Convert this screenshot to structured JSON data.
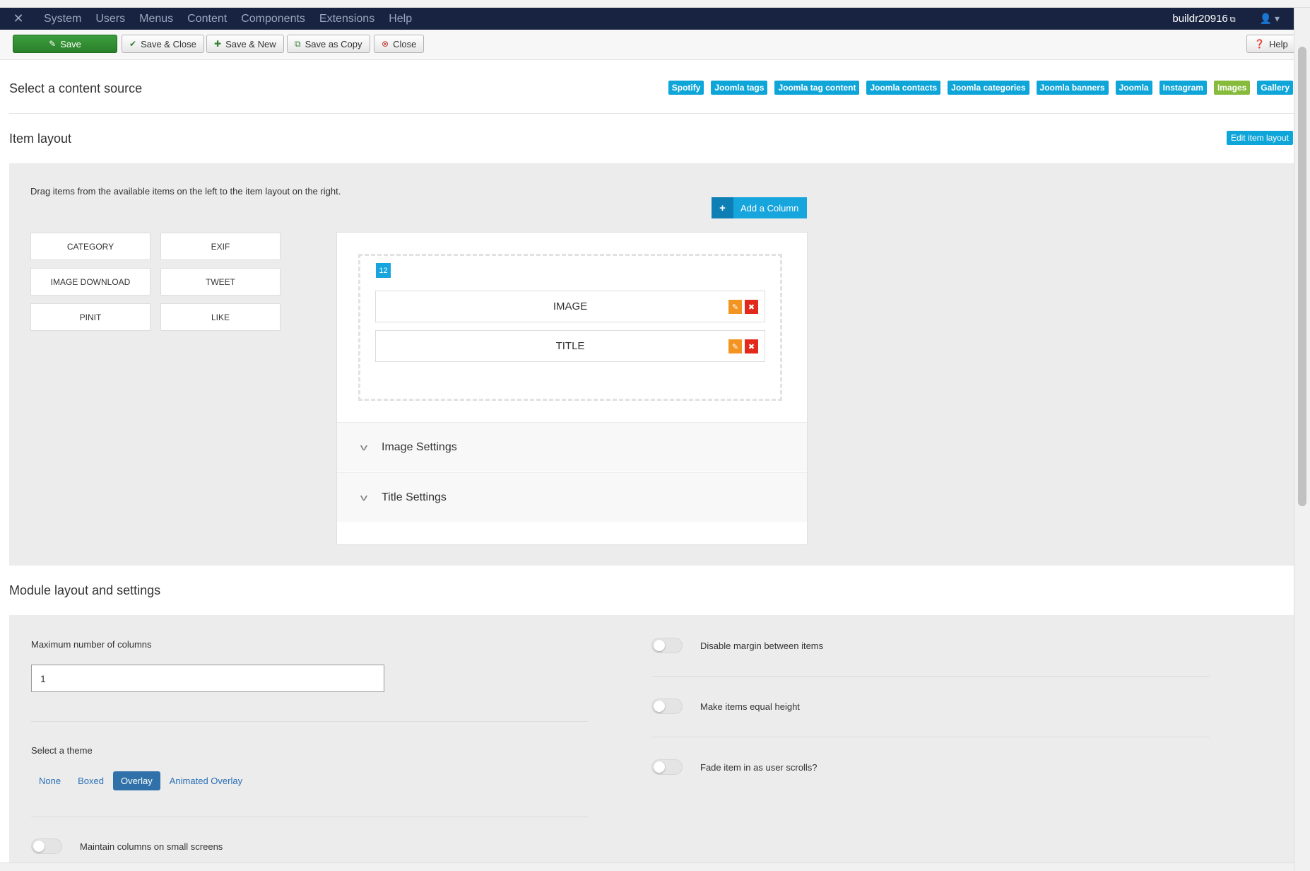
{
  "navbar": {
    "menu": [
      "System",
      "Users",
      "Menus",
      "Content",
      "Components",
      "Extensions",
      "Help"
    ],
    "user": "buildr20916"
  },
  "toolbar": {
    "save": "Save",
    "save_close": "Save & Close",
    "save_new": "Save & New",
    "save_copy": "Save as Copy",
    "close": "Close",
    "help": "Help"
  },
  "content_source": {
    "title": "Select a content source",
    "tags": [
      "Spotify",
      "Joomla tags",
      "Joomla tag content",
      "Joomla contacts",
      "Joomla categories",
      "Joomla banners",
      "Joomla",
      "Instagram",
      "Images",
      "Gallery"
    ],
    "active_tag": "Images"
  },
  "item_layout": {
    "title": "Item layout",
    "edit_button": "Edit item layout",
    "hint": "Drag items from the available items on the left to the item layout on the right.",
    "available_items": [
      "CATEGORY",
      "EXIF",
      "IMAGE DOWNLOAD",
      "TWEET",
      "PINIT",
      "LIKE"
    ],
    "add_column": "Add a Column",
    "column_width": "12",
    "layout_items": [
      "IMAGE",
      "TITLE"
    ],
    "settings_sections": [
      "Image Settings",
      "Title Settings"
    ]
  },
  "module_layout": {
    "title": "Module layout and settings",
    "max_columns_label": "Maximum number of columns",
    "max_columns_value": "1",
    "theme_label": "Select a theme",
    "themes": [
      "None",
      "Boxed",
      "Overlay",
      "Animated Overlay"
    ],
    "active_theme": "Overlay",
    "maintain_columns_label": "Maintain columns on small screens",
    "disable_margin_label": "Disable margin between items",
    "equal_height_label": "Make items equal height",
    "fade_in_label": "Fade item in as user scrolls?"
  },
  "colors": {
    "navbar_bg": "#172340",
    "accent_blue": "#0ea5d9",
    "active_green": "#86bb3b",
    "save_green": "#2f8a2f",
    "edit_orange": "#f39322",
    "delete_red": "#e3281c"
  }
}
